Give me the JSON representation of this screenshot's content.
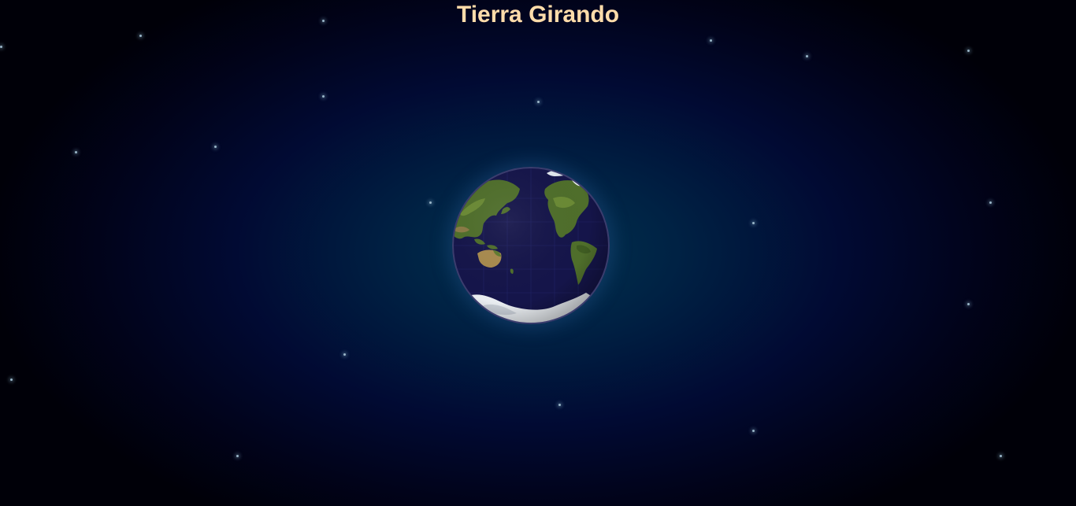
{
  "page": {
    "title": "Tierra Girando"
  },
  "theme": {
    "title_color": "#ffdcaa",
    "space_center": "#00334f",
    "space_edge": "#000008",
    "ocean": "#15154a",
    "land": "#4f6e2b",
    "ice": "#e8ecf0",
    "star": "#9ab6c8"
  },
  "earth": {
    "icon": "earth-globe"
  }
}
